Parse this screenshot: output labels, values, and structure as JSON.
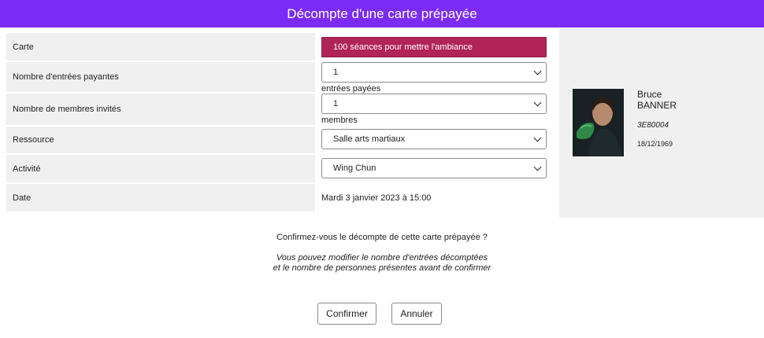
{
  "dialog": {
    "title": "Décompte d'une carte prépayée"
  },
  "form": {
    "card": {
      "label": "Carte",
      "value": "100 séances pour mettre l'ambiance"
    },
    "paid_entries": {
      "label": "Nombre d'entrées payantes",
      "value": "1",
      "unit": "entrées payées"
    },
    "guests": {
      "label": "Nombre de membres invités",
      "value": "1",
      "unit": "membres"
    },
    "resource": {
      "label": "Ressource",
      "value": "Salle arts martiaux"
    },
    "activity": {
      "label": "Activité",
      "value": "Wing Chun"
    },
    "date": {
      "label": "Date",
      "value": "Mardi 3 janvier 2023 à 15:00"
    }
  },
  "member": {
    "first_name": "Bruce",
    "last_name": "BANNER",
    "id": "3E80004",
    "birthdate": "18/12/1969"
  },
  "confirmation": {
    "question": "Confirmez-vous le décompte de cette carte prépayée ?",
    "note_line1": "Vous pouvez modifier le nombre d'entrées décomptées",
    "note_line2": "et le nombre de personnes présentes avant de confirmer"
  },
  "buttons": {
    "confirm": "Confirmer",
    "cancel": "Annuler"
  },
  "colors": {
    "header": "#7a2cf5",
    "card_button": "#b02456",
    "panel": "#f0f0f0"
  }
}
